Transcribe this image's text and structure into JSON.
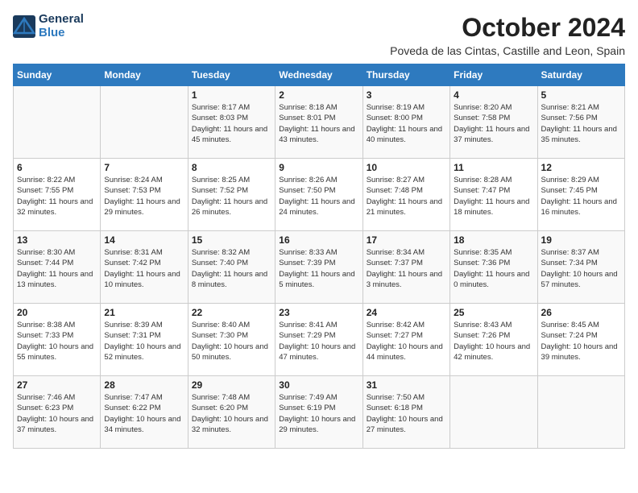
{
  "logo": {
    "general": "General",
    "blue": "Blue"
  },
  "title": "October 2024",
  "location": "Poveda de las Cintas, Castille and Leon, Spain",
  "weekdays": [
    "Sunday",
    "Monday",
    "Tuesday",
    "Wednesday",
    "Thursday",
    "Friday",
    "Saturday"
  ],
  "weeks": [
    [
      {
        "day": "",
        "text": ""
      },
      {
        "day": "",
        "text": ""
      },
      {
        "day": "1",
        "text": "Sunrise: 8:17 AM\nSunset: 8:03 PM\nDaylight: 11 hours and 45 minutes."
      },
      {
        "day": "2",
        "text": "Sunrise: 8:18 AM\nSunset: 8:01 PM\nDaylight: 11 hours and 43 minutes."
      },
      {
        "day": "3",
        "text": "Sunrise: 8:19 AM\nSunset: 8:00 PM\nDaylight: 11 hours and 40 minutes."
      },
      {
        "day": "4",
        "text": "Sunrise: 8:20 AM\nSunset: 7:58 PM\nDaylight: 11 hours and 37 minutes."
      },
      {
        "day": "5",
        "text": "Sunrise: 8:21 AM\nSunset: 7:56 PM\nDaylight: 11 hours and 35 minutes."
      }
    ],
    [
      {
        "day": "6",
        "text": "Sunrise: 8:22 AM\nSunset: 7:55 PM\nDaylight: 11 hours and 32 minutes."
      },
      {
        "day": "7",
        "text": "Sunrise: 8:24 AM\nSunset: 7:53 PM\nDaylight: 11 hours and 29 minutes."
      },
      {
        "day": "8",
        "text": "Sunrise: 8:25 AM\nSunset: 7:52 PM\nDaylight: 11 hours and 26 minutes."
      },
      {
        "day": "9",
        "text": "Sunrise: 8:26 AM\nSunset: 7:50 PM\nDaylight: 11 hours and 24 minutes."
      },
      {
        "day": "10",
        "text": "Sunrise: 8:27 AM\nSunset: 7:48 PM\nDaylight: 11 hours and 21 minutes."
      },
      {
        "day": "11",
        "text": "Sunrise: 8:28 AM\nSunset: 7:47 PM\nDaylight: 11 hours and 18 minutes."
      },
      {
        "day": "12",
        "text": "Sunrise: 8:29 AM\nSunset: 7:45 PM\nDaylight: 11 hours and 16 minutes."
      }
    ],
    [
      {
        "day": "13",
        "text": "Sunrise: 8:30 AM\nSunset: 7:44 PM\nDaylight: 11 hours and 13 minutes."
      },
      {
        "day": "14",
        "text": "Sunrise: 8:31 AM\nSunset: 7:42 PM\nDaylight: 11 hours and 10 minutes."
      },
      {
        "day": "15",
        "text": "Sunrise: 8:32 AM\nSunset: 7:40 PM\nDaylight: 11 hours and 8 minutes."
      },
      {
        "day": "16",
        "text": "Sunrise: 8:33 AM\nSunset: 7:39 PM\nDaylight: 11 hours and 5 minutes."
      },
      {
        "day": "17",
        "text": "Sunrise: 8:34 AM\nSunset: 7:37 PM\nDaylight: 11 hours and 3 minutes."
      },
      {
        "day": "18",
        "text": "Sunrise: 8:35 AM\nSunset: 7:36 PM\nDaylight: 11 hours and 0 minutes."
      },
      {
        "day": "19",
        "text": "Sunrise: 8:37 AM\nSunset: 7:34 PM\nDaylight: 10 hours and 57 minutes."
      }
    ],
    [
      {
        "day": "20",
        "text": "Sunrise: 8:38 AM\nSunset: 7:33 PM\nDaylight: 10 hours and 55 minutes."
      },
      {
        "day": "21",
        "text": "Sunrise: 8:39 AM\nSunset: 7:31 PM\nDaylight: 10 hours and 52 minutes."
      },
      {
        "day": "22",
        "text": "Sunrise: 8:40 AM\nSunset: 7:30 PM\nDaylight: 10 hours and 50 minutes."
      },
      {
        "day": "23",
        "text": "Sunrise: 8:41 AM\nSunset: 7:29 PM\nDaylight: 10 hours and 47 minutes."
      },
      {
        "day": "24",
        "text": "Sunrise: 8:42 AM\nSunset: 7:27 PM\nDaylight: 10 hours and 44 minutes."
      },
      {
        "day": "25",
        "text": "Sunrise: 8:43 AM\nSunset: 7:26 PM\nDaylight: 10 hours and 42 minutes."
      },
      {
        "day": "26",
        "text": "Sunrise: 8:45 AM\nSunset: 7:24 PM\nDaylight: 10 hours and 39 minutes."
      }
    ],
    [
      {
        "day": "27",
        "text": "Sunrise: 7:46 AM\nSunset: 6:23 PM\nDaylight: 10 hours and 37 minutes."
      },
      {
        "day": "28",
        "text": "Sunrise: 7:47 AM\nSunset: 6:22 PM\nDaylight: 10 hours and 34 minutes."
      },
      {
        "day": "29",
        "text": "Sunrise: 7:48 AM\nSunset: 6:20 PM\nDaylight: 10 hours and 32 minutes."
      },
      {
        "day": "30",
        "text": "Sunrise: 7:49 AM\nSunset: 6:19 PM\nDaylight: 10 hours and 29 minutes."
      },
      {
        "day": "31",
        "text": "Sunrise: 7:50 AM\nSunset: 6:18 PM\nDaylight: 10 hours and 27 minutes."
      },
      {
        "day": "",
        "text": ""
      },
      {
        "day": "",
        "text": ""
      }
    ]
  ]
}
